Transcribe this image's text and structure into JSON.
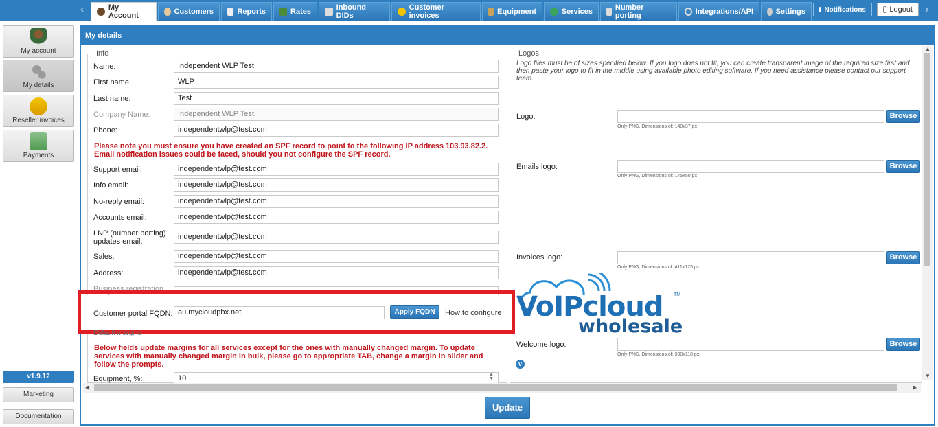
{
  "nav": {
    "tabs": [
      {
        "label": "My Account",
        "icon": "user-icon"
      },
      {
        "label": "Customers",
        "icon": "customers-icon"
      },
      {
        "label": "Reports",
        "icon": "report-icon"
      },
      {
        "label": "Rates",
        "icon": "rates-icon"
      },
      {
        "label": "Inbound DIDs",
        "icon": "inbound-icon"
      },
      {
        "label": "Customer invoices",
        "icon": "invoice-icon"
      },
      {
        "label": "Equipment",
        "icon": "equipment-icon"
      },
      {
        "label": "Services",
        "icon": "services-icon"
      },
      {
        "label": "Number porting",
        "icon": "porting-icon"
      },
      {
        "label": "Integrations/API",
        "icon": "api-icon"
      },
      {
        "label": "Settings",
        "icon": "gear-icon"
      },
      {
        "label": "Notifications",
        "icon": "mail-icon"
      },
      {
        "label": "Logout",
        "icon": "logout-icon"
      }
    ]
  },
  "sidebar": {
    "items": [
      {
        "label": "My account"
      },
      {
        "label": "My details"
      },
      {
        "label": "Reseller invoices"
      },
      {
        "label": "Payments"
      }
    ],
    "version": "v1.9.12",
    "marketing": "Marketing",
    "documentation": "Documentation"
  },
  "main": {
    "title": "My details",
    "info_legend": "Info",
    "logos_legend": "Logos",
    "fields": [
      {
        "label": "Name:",
        "value": "Independent WLP Test"
      },
      {
        "label": "First name:",
        "value": "WLP"
      },
      {
        "label": "Last name:",
        "value": "Test"
      },
      {
        "label": "Company Name:",
        "value": "Independent WLP Test"
      },
      {
        "label": "Phone:",
        "value": "independentwlp@test.com"
      }
    ],
    "spf_warning": "Please note you must ensure you have created an SPF record to point to the following IP address 103.93.82.2. Email notification issues could be faced, should you not configure the SPF record.",
    "emails": [
      {
        "label": "Support email:",
        "value": "independentwlp@test.com"
      },
      {
        "label": "Info email:",
        "value": "independentwlp@test.com"
      },
      {
        "label": "No-reply email:",
        "value": "independentwlp@test.com"
      },
      {
        "label": "Accounts email:",
        "value": "independentwlp@test.com"
      },
      {
        "label": "LNP (number porting) updates email:",
        "value": "independentwlp@test.com"
      },
      {
        "label": "Sales:",
        "value": "independentwlp@test.com"
      },
      {
        "label": "Address:",
        "value": "independentwlp@test.com"
      }
    ],
    "business_reg_label": "Business registration number:",
    "fqdn_label": "Customer portal FQDN:",
    "fqdn_value": "au.mycloudpbx.net",
    "apply_fqdn": "Apply FQDN",
    "how_to": "How to configure",
    "margins_legend": "Default margins",
    "margins_warning": "Below fields update margins for all services except for the ones with manually changed margin. To update services with manually changed margin in bulk, please go to appropriate TAB, change a margin in slider and follow the prompts.",
    "equipment_label": "Equipment, %:",
    "equipment_value": "10",
    "logos_intro": "Logo files must be of sizes specified below. If you logo does not fit, you can create transparent image of the required size first and then paste your logo to fit in the middle using available photo editing software. If you need assistance please contact our support team.",
    "logos": [
      {
        "label": "Logo:",
        "hint": "Only PNG, Dimensions of: 140x37 px"
      },
      {
        "label": "Emails logo:",
        "hint": "Only PNG, Dimensions of: 175x50 px"
      },
      {
        "label": "Invoices logo:",
        "hint": "Only PNG, Dimensions of: 411x125 px"
      },
      {
        "label": "Welcome logo:",
        "hint": "Only PNG, Dimensions of: 300x118 px"
      }
    ],
    "browse": "Browse",
    "update": "Update",
    "watermark_top": "VoIPcloud",
    "watermark_bottom": "wholesale",
    "watermark_tm": "TM"
  },
  "colors": {
    "accent": "#2f7ebf",
    "warning": "#c0161c",
    "highlight": "#e01f25"
  }
}
